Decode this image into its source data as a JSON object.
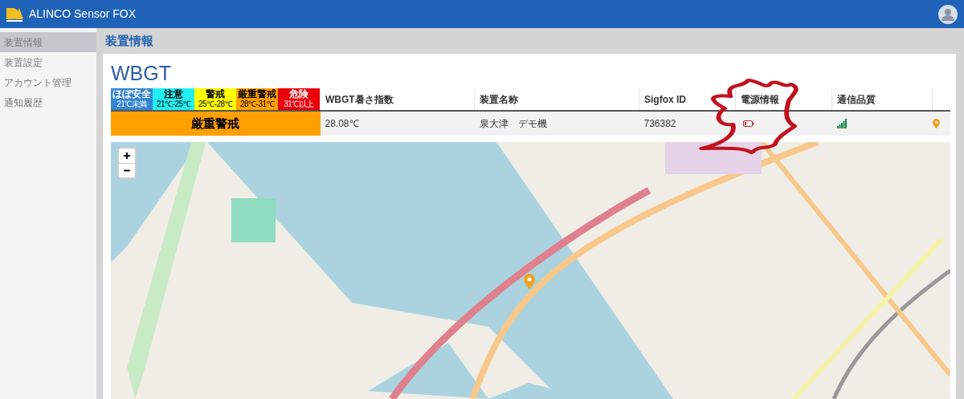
{
  "app": {
    "title": "ALINCO Sensor FOX"
  },
  "sidebar": {
    "items": [
      {
        "label": "装置情報",
        "selected": true
      },
      {
        "label": "装置設定",
        "selected": false
      },
      {
        "label": "アカウント管理",
        "selected": false
      },
      {
        "label": "通知履歴",
        "selected": false
      }
    ]
  },
  "page_title": "装置情報",
  "card": {
    "title": "WBGT",
    "legend": [
      {
        "label": "ほぼ安全",
        "range": "21℃未満",
        "color": "#3585d0"
      },
      {
        "label": "注意",
        "range": "21℃-25℃",
        "color": "#22eef0"
      },
      {
        "label": "警戒",
        "range": "25℃-28℃",
        "color": "#ffff00"
      },
      {
        "label": "厳重警戒",
        "range": "28℃-31℃",
        "color": "#ffa000"
      },
      {
        "label": "危険",
        "range": "31℃以上",
        "color": "#e8000b"
      }
    ],
    "current_level": {
      "label": "厳重警戒",
      "color": "#ffa000"
    },
    "table": {
      "columns": [
        "WBGT暑さ指数",
        "装置名称",
        "Sigfox ID",
        "電源情報",
        "通信品質"
      ],
      "row": {
        "wbgt": "28.08℃",
        "device_name": "泉大津　デモ機",
        "sigfox_id": "736382",
        "battery_low": true
      }
    }
  }
}
